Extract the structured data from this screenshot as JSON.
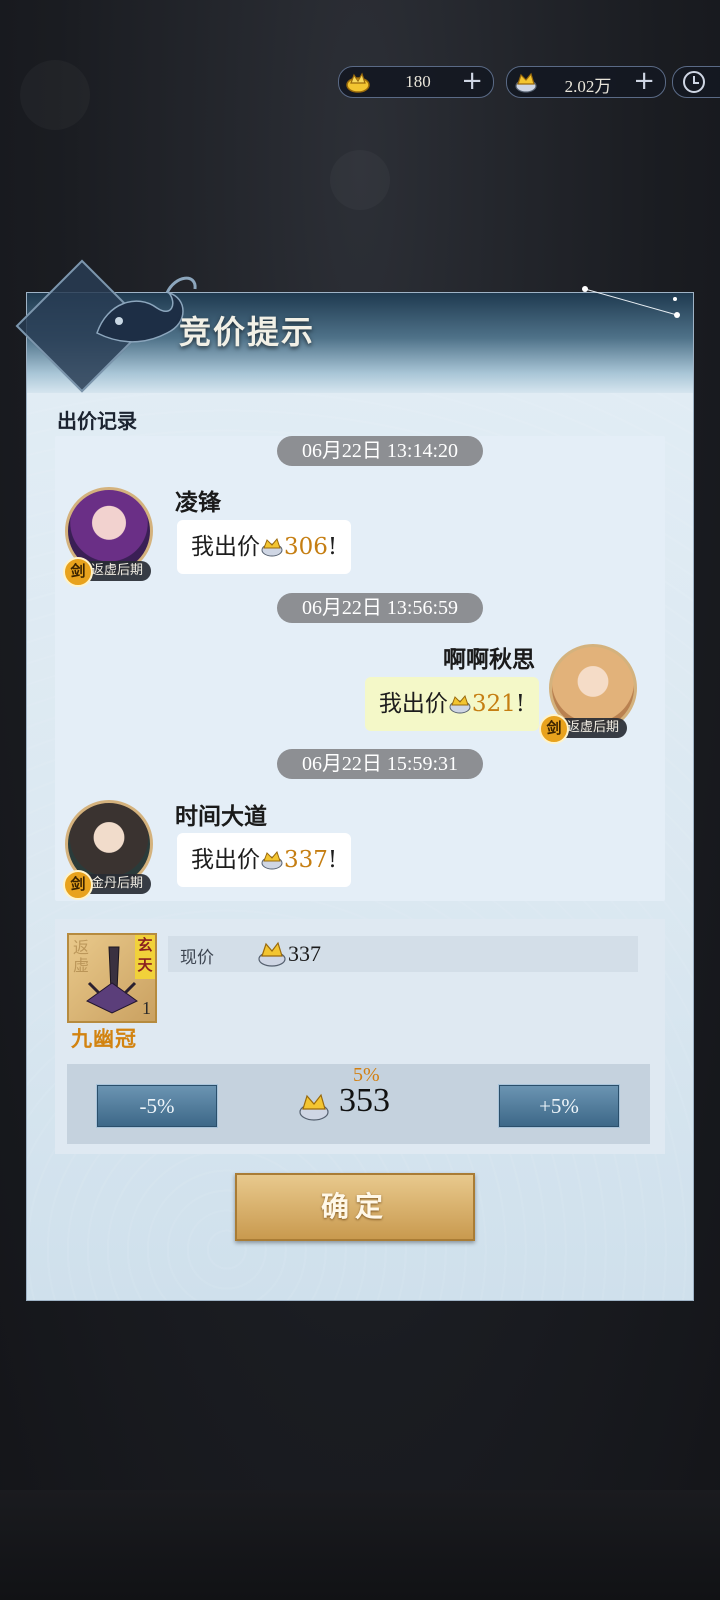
{
  "currency": {
    "primary_value": "180",
    "secondary_value": "2.02万",
    "coin_color": "#f3c531"
  },
  "dialog": {
    "title": "竞价提示",
    "section_label": "出价记录",
    "records": [
      {
        "time": "06月22日 13:14:20",
        "name": "凌锋",
        "rank": "返虚后期",
        "sect_badge": "剑",
        "bid_prefix": "我出价",
        "amount": "306",
        "bid_suffix": "!",
        "side": "left"
      },
      {
        "time": "06月22日 13:56:59",
        "name": "啊啊秋思",
        "rank": "返虚后期",
        "sect_badge": "剑",
        "bid_prefix": "我出价",
        "amount": "321",
        "bid_suffix": "!",
        "side": "right"
      },
      {
        "time": "06月22日 15:59:31",
        "name": "时间大道",
        "rank": "金丹后期",
        "sect_badge": "剑",
        "bid_prefix": "我出价",
        "amount": "337",
        "bid_suffix": "!",
        "side": "left"
      }
    ],
    "item": {
      "name": "九幽冠",
      "grade": "玄天",
      "bg_text": "返虚",
      "count": "1",
      "current_price_label": "现价",
      "current_price": "337"
    },
    "bid": {
      "minus_label": "-5%",
      "plus_label": "+5%",
      "step_pct": "5%",
      "value": "353"
    },
    "confirm_label": "确定"
  }
}
